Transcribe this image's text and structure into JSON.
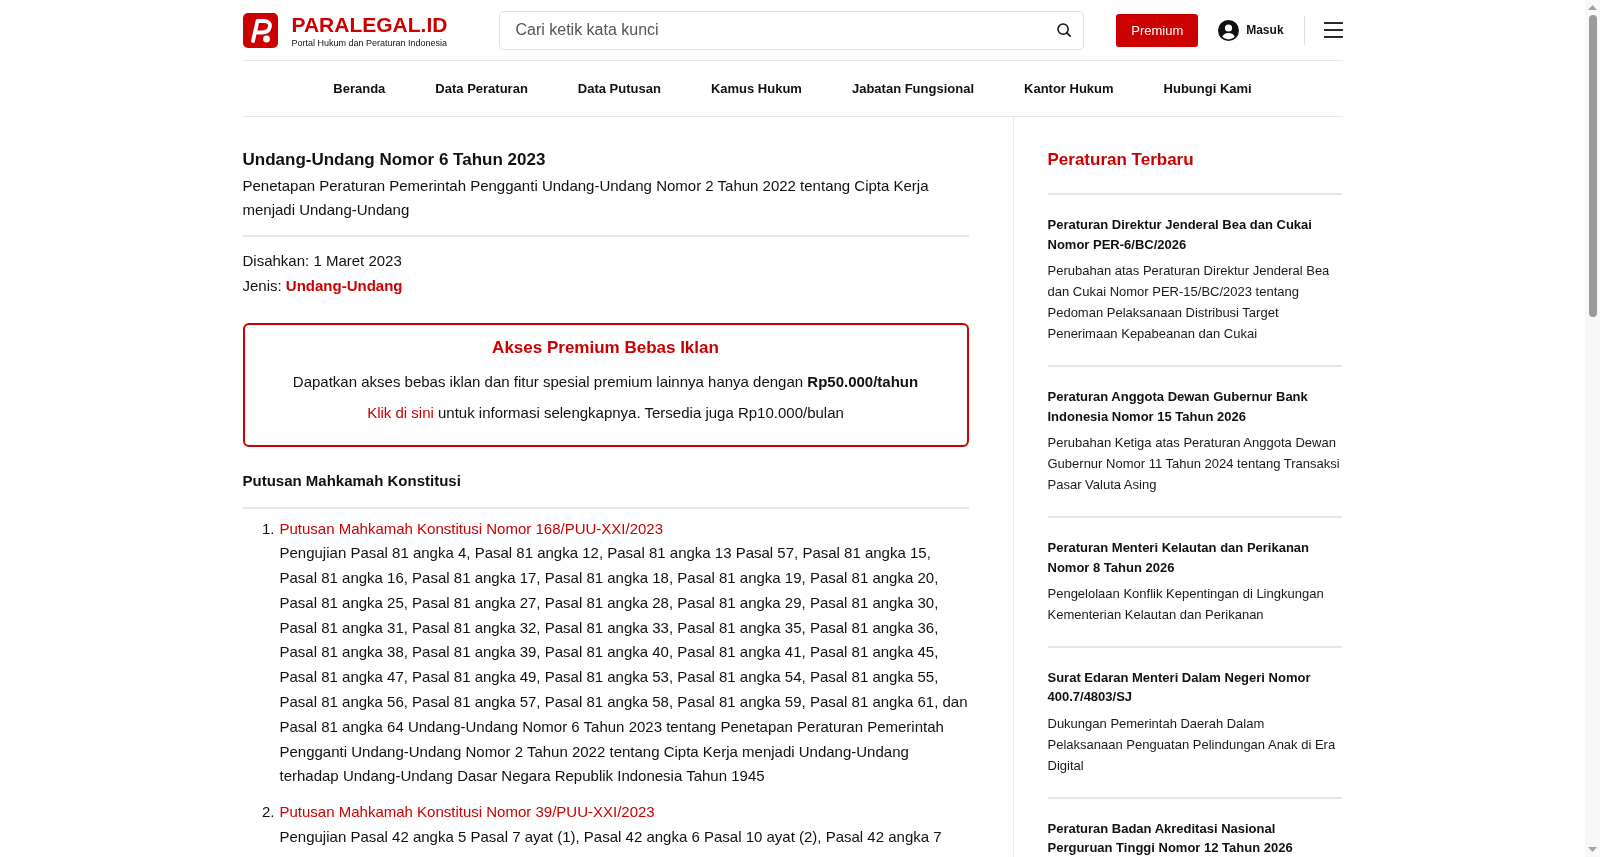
{
  "header": {
    "brand": {
      "name": "PARALEGAL.ID",
      "tagline": "Portal Hukum dan Peraturan Indonesia"
    },
    "search": {
      "placeholder": "Cari ketik kata kunci"
    },
    "premium_button": "Premium",
    "login": "Masuk"
  },
  "nav": [
    "Beranda",
    "Data Peraturan",
    "Data Putusan",
    "Kamus Hukum",
    "Jabatan Fungsional",
    "Kantor Hukum",
    "Hubungi Kami"
  ],
  "document": {
    "title": "Undang-Undang Nomor 6 Tahun 2023",
    "subtitle": "Penetapan Peraturan Pemerintah Pengganti Undang-Undang Nomor 2 Tahun 2022 tentang Cipta Kerja menjadi Undang-Undang",
    "meta": [
      {
        "kind": "text",
        "label": "Disahkan:",
        "value": "1 Maret 2023"
      },
      {
        "kind": "link",
        "label": "Jenis:",
        "value": "Undang-Undang"
      }
    ]
  },
  "promo": {
    "title": "Akses Premium Bebas Iklan",
    "text": "Dapatkan akses bebas iklan dan fitur spesial premium lainnya hanya dengan **Rp50.000/tahun**",
    "link": "Klik di sini",
    "link_text": "untuk informasi selengkapnya. Tersedia juga Rp10.000/bulan"
  },
  "decisions": {
    "title": "Putusan Mahkamah Konstitusi",
    "items": [
      {
        "number": "1.",
        "title": "Putusan Mahkamah Konstitusi Nomor 168/PUU-XXI/2023",
        "description": "Pengujian Pasal 81 angka 4, Pasal 81 angka 12, Pasal 81 angka 13 Pasal 57, Pasal 81 angka 15, Pasal 81 angka 16, Pasal 81 angka 17, Pasal 81 angka 18, Pasal 81 angka 19, Pasal 81 angka 20, Pasal 81 angka 25, Pasal 81 angka 27, Pasal 81 angka 28, Pasal 81 angka 29, Pasal 81 angka 30, Pasal 81 angka 31, Pasal 81 angka 32, Pasal 81 angka 33, Pasal 81 angka 35, Pasal 81 angka 36, Pasal 81 angka 38, Pasal 81 angka 39, Pasal 81 angka 40, Pasal 81 angka 41, Pasal 81 angka 45, Pasal 81 angka 47, Pasal 81 angka 49, Pasal 81 angka 53, Pasal 81 angka 54, Pasal 81 angka 55, Pasal 81 angka 56, Pasal 81 angka 57, Pasal 81 angka 58, Pasal 81 angka 59, Pasal 81 angka 61, dan Pasal 81 angka 64 Undang-Undang Nomor 6 Tahun 2023 tentang Penetapan Peraturan Pemerintah Pengganti Undang-Undang Nomor 2 Tahun 2022 tentang Cipta Kerja menjadi Undang-Undang terhadap Undang-Undang Dasar Negara Republik Indonesia Tahun 1945"
      },
      {
        "number": "2.",
        "title": "Putusan Mahkamah Konstitusi Nomor 39/PUU-XXI/2023",
        "description": "Pengujian Pasal 42 angka 5 Pasal 7 ayat (1), Pasal 42 angka 6 Pasal 10 ayat (2), Pasal 42 angka 7"
      }
    ]
  },
  "sidebar": {
    "title": "Peraturan Terbaru",
    "items": [
      {
        "title": "Peraturan Direktur Jenderal Bea dan Cukai Nomor PER-6/BC/2026",
        "description": "Perubahan atas Peraturan Direktur Jenderal Bea dan Cukai Nomor PER-15/BC/2023 tentang Pedoman Pelaksanaan Distribusi Target Penerimaan Kepabeanan dan Cukai"
      },
      {
        "title": "Peraturan Anggota Dewan Gubernur Bank Indonesia Nomor 15 Tahun 2026",
        "description": "Perubahan Ketiga atas Peraturan Anggota Dewan Gubernur Nomor 11 Tahun 2024 tentang Transaksi Pasar Valuta Asing"
      },
      {
        "title": "Peraturan Menteri Kelautan dan Perikanan Nomor 8 Tahun 2026",
        "description": "Pengelolaan Konflik Kepentingan di Lingkungan Kementerian Kelautan dan Perikanan"
      },
      {
        "title": "Surat Edaran Menteri Dalam Negeri Nomor 400.7/4803/SJ",
        "description": "Dukungan Pemerintah Daerah Dalam Pelaksanaan Penguatan Pelindungan Anak di Era Digital"
      },
      {
        "title": "Peraturan Badan Akreditasi Nasional Perguruan Tinggi Nomor 12 Tahun 2026"
      }
    ]
  }
}
